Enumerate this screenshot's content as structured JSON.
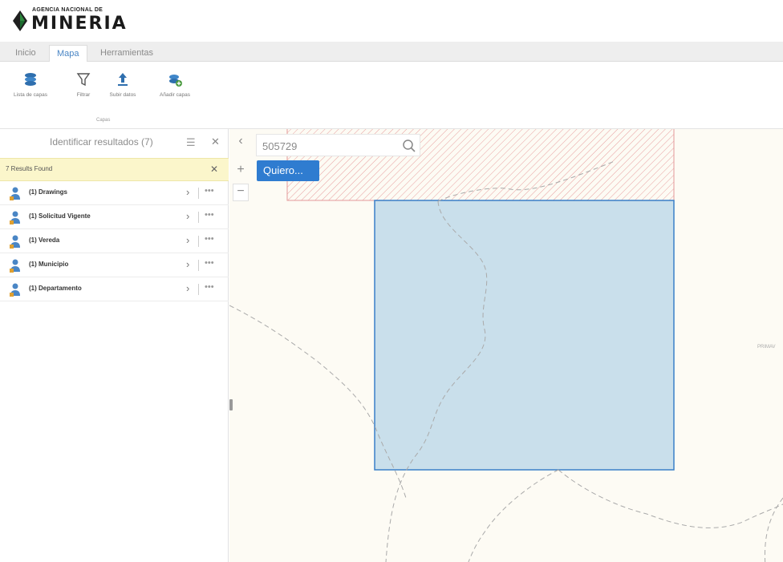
{
  "brand": {
    "top_text": "AGENCIA NACIONAL DE",
    "name": "MINERIA",
    "color": "#1b6b2e"
  },
  "tabs": [
    {
      "label": "Inicio"
    },
    {
      "label": "Mapa",
      "active": true
    },
    {
      "label": "Herramientas"
    }
  ],
  "ribbon": {
    "buttons": [
      {
        "label": "Lista de capas",
        "icon": "layers-icon"
      },
      {
        "label": "Filtrar",
        "icon": "filter-icon"
      },
      {
        "label": "Subir datos",
        "icon": "upload-icon"
      },
      {
        "label": "Añadir capas",
        "icon": "add-layers-icon"
      }
    ],
    "group_label": "Capas"
  },
  "panel": {
    "title": "Identificar resultados (7)",
    "found_text": "7 Results Found",
    "results": [
      {
        "label": "(1) Drawings"
      },
      {
        "label": "(1) Solicitud Vigente"
      },
      {
        "label": "(1) Vereda"
      },
      {
        "label": "(1) Municipio"
      },
      {
        "label": "(1) Departamento"
      }
    ]
  },
  "map": {
    "search_value": "505729",
    "quiero_label": "Quiero...",
    "place_label": "PRIMAV",
    "colors": {
      "background": "#fdfbf4",
      "selection_fill": "#c9dfeb",
      "selection_stroke": "#3a7fc8",
      "hatch": "#e8a0a0",
      "accent": "#2f7cd0"
    }
  }
}
